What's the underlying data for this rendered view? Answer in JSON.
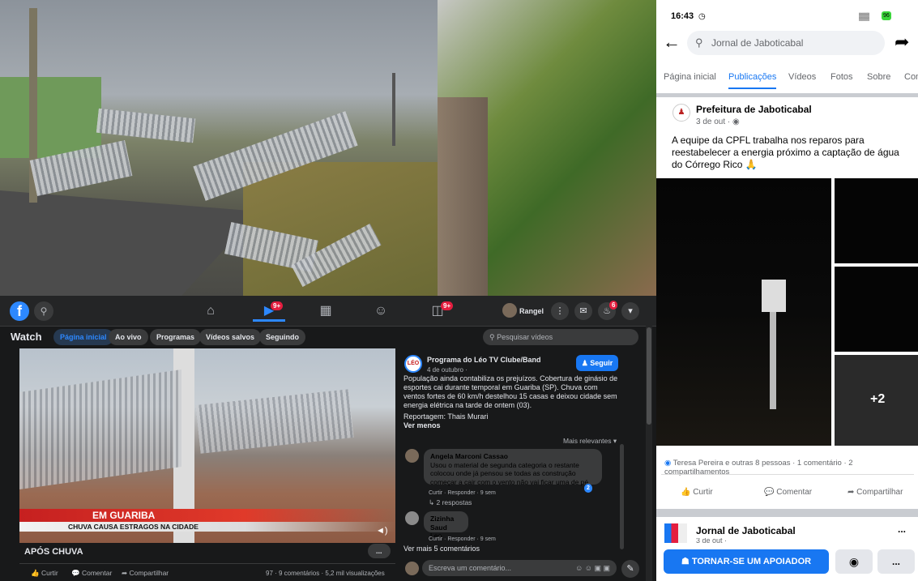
{
  "watch": {
    "profile_name": "Rangel",
    "badge_video": "9+",
    "badge_groups": "9+",
    "badge_notif": "6",
    "title": "Watch",
    "chips": [
      "Página inicial",
      "Ao vivo",
      "Programas",
      "Vídeos salvos",
      "Seguindo"
    ],
    "search_placeholder": "Pesquisar vídeos",
    "overlay_main": "EM GUARIBA",
    "overlay_sub": "CHUVA CAUSA ESTRAGOS NA CIDADE",
    "video_title": "APÓS CHUVA",
    "more_btn": "...",
    "actions": {
      "like": "Curtir",
      "comment": "Comentar",
      "share": "Compartilhar"
    },
    "stats": "97 · 9 comentários · 5,2 mil visualizações",
    "channel_logo": "LÉO",
    "channel": "Programa do Léo TV Clube/Band",
    "date": "4 de outubro ·",
    "follow": "Seguir",
    "description": "População ainda contabiliza os prejuízos. Cobertura de ginásio de esportes cai durante temporal em Guariba (SP). Chuva com ventos fortes de 60 km/h destelhou 15 casas e deixou cidade sem energia elétrica na tarde de ontem (03).",
    "reporter": "Reportagem: Thais Murari",
    "see_less": "Ver menos",
    "sort": "Mais relevantes",
    "comments": [
      {
        "name": "Angela Marconi Cassao",
        "text": "Usou o material de segunda categoria o restante colocou onde já pensou se todas as construção começar a cair com o vento não vai ficar uma de pé",
        "meta": "Curtir · Responder · 9 sem",
        "reactions": "2",
        "replies": "2 respostas"
      },
      {
        "name": "Zizinha Saud",
        "text": "Leo",
        "meta": "Curtir · Responder · 9 sem"
      }
    ],
    "more_comments": "Ver mais 5 comentários",
    "comment_placeholder": "Escreva um comentário..."
  },
  "mobile": {
    "time": "16:43",
    "battery": "96",
    "search_text": "Jornal de Jaboticabal",
    "tabs": [
      "Página inicial",
      "Publicações",
      "Vídeos",
      "Fotos",
      "Sobre",
      "Con"
    ],
    "post_author": "Prefeitura de Jaboticabal",
    "post_date": "3 de out ·",
    "post_text": "A equipe da CPFL trabalha nos reparos para reestabelecer a energia próximo a captação de água do Córrego Rico 🙏",
    "more_photos": "+2",
    "reactions": "Teresa Pereira e outras 8 pessoas · 1 comentário · 2 compartilhamentos",
    "actions": {
      "like": "Curtir",
      "comment": "Comentar",
      "share": "Compartilhar"
    },
    "next_author": "Jornal de Jaboticabal",
    "next_date": "3 de out ·",
    "next_more": "...",
    "support_btn": "TORNAR-SE UM APOIADOR",
    "more_btn": "..."
  }
}
